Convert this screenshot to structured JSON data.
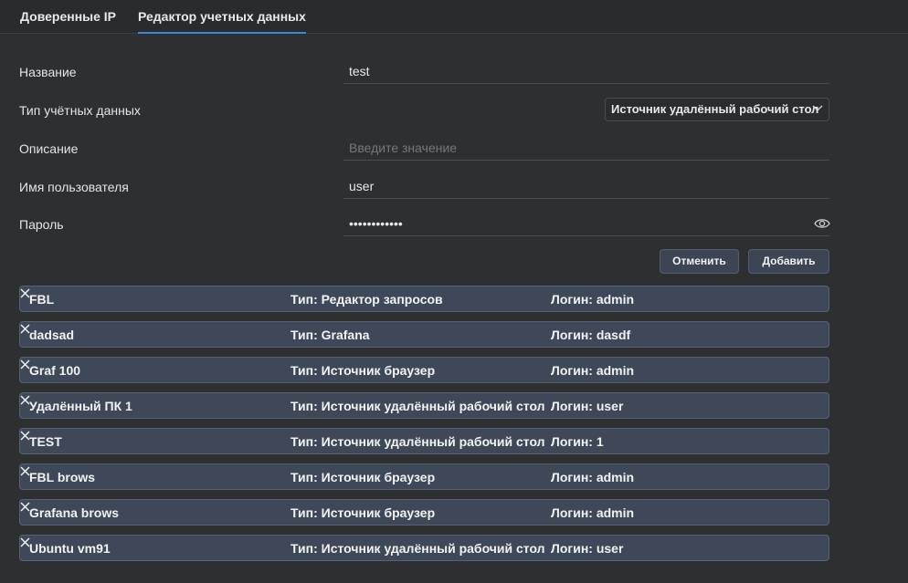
{
  "tabs": [
    {
      "label": "Доверенные IP",
      "active": false
    },
    {
      "label": "Редактор учетных данных",
      "active": true
    }
  ],
  "form": {
    "name": {
      "label": "Название",
      "value": "test"
    },
    "type": {
      "label": "Тип учётных данных",
      "value": "Источник удалённый рабочий стол"
    },
    "description": {
      "label": "Описание",
      "value": "",
      "placeholder": "Введите значение"
    },
    "username": {
      "label": "Имя пользователя",
      "value": "user"
    },
    "password": {
      "label": "Пароль",
      "value": "••••••••••••"
    }
  },
  "buttons": {
    "cancel": "Отменить",
    "add": "Добавить"
  },
  "credentials": [
    {
      "name": "FBL",
      "type": "Тип: Редактор запросов",
      "login": "Логин: admin"
    },
    {
      "name": "dadsad",
      "type": "Тип: Grafana",
      "login": "Логин: dasdf"
    },
    {
      "name": "Graf 100",
      "type": "Тип: Источник браузер",
      "login": "Логин: admin"
    },
    {
      "name": "Удалённый ПК 1",
      "type": "Тип: Источник удалённый рабочий стол",
      "login": "Логин: user"
    },
    {
      "name": "TEST",
      "type": "Тип: Источник удалённый рабочий стол",
      "login": "Логин: 1"
    },
    {
      "name": "FBL brows",
      "type": "Тип: Источник браузер",
      "login": "Логин: admin"
    },
    {
      "name": "Grafana brows",
      "type": "Тип: Источник браузер",
      "login": "Логин: admin"
    },
    {
      "name": "Ubuntu vm91",
      "type": "Тип: Источник удалённый рабочий стол",
      "login": "Логин: user"
    }
  ],
  "colors": {
    "background": "#2e2f31",
    "accent": "#3f87d8",
    "row_bg": "#3f4859"
  },
  "icons": {
    "select": "chevron-down-icon",
    "password": "eye-icon",
    "row_action": "close-icon"
  }
}
